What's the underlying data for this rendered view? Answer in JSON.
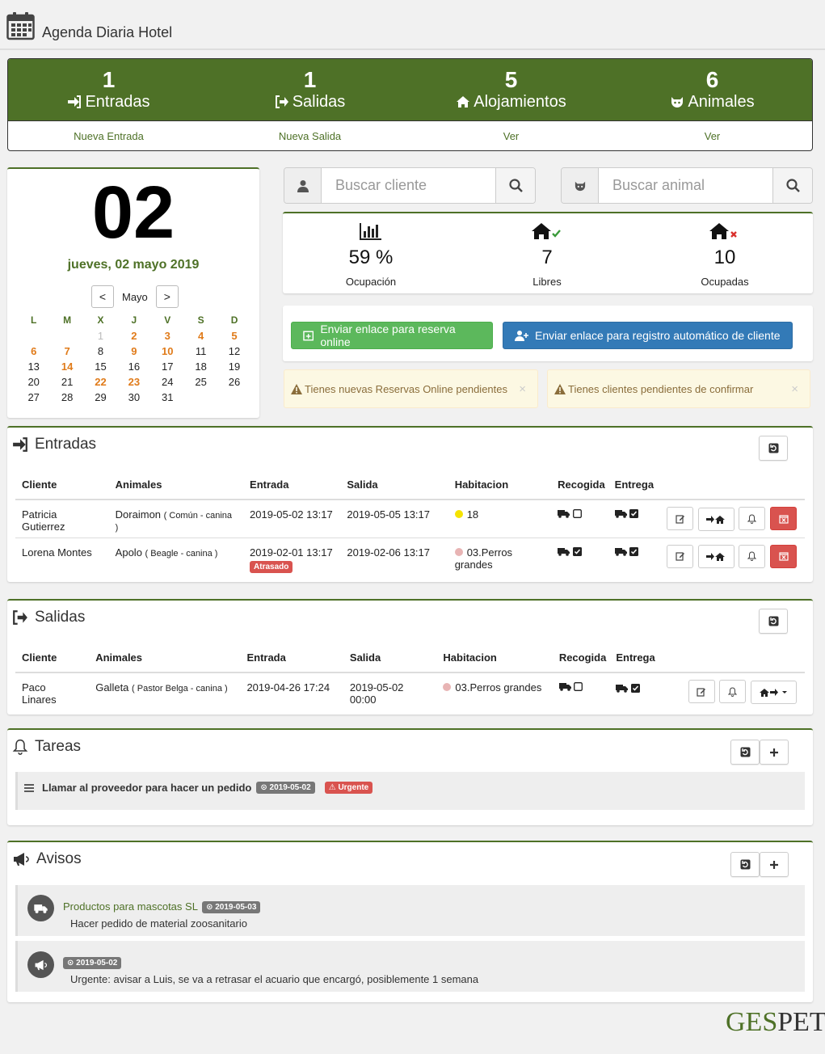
{
  "app": {
    "title": "Agenda Diaria Hotel"
  },
  "stats": [
    {
      "count": "1",
      "label": "Entradas",
      "link": "Nueva Entrada",
      "icon": "sign-in-icon"
    },
    {
      "count": "1",
      "label": "Salidas",
      "link": "Nueva Salida",
      "icon": "sign-out-icon"
    },
    {
      "count": "5",
      "label": "Alojamientos",
      "link": "Ver",
      "icon": "home-icon"
    },
    {
      "count": "6",
      "label": "Animales",
      "link": "Ver",
      "icon": "animal-icon"
    }
  ],
  "calendar": {
    "day": "02",
    "date_text": "jueves, 02 mayo 2019",
    "prev": "<",
    "next": ">",
    "month": "Mayo",
    "weekdays": [
      "L",
      "M",
      "X",
      "J",
      "V",
      "S",
      "D"
    ],
    "weeks": [
      [
        "",
        "",
        "1",
        "2",
        "3",
        "4",
        "5"
      ],
      [
        "6",
        "7",
        "8",
        "9",
        "10",
        "11",
        "12"
      ],
      [
        "13",
        "14",
        "15",
        "16",
        "17",
        "18",
        "19"
      ],
      [
        "20",
        "21",
        "22",
        "23",
        "24",
        "25",
        "26"
      ],
      [
        "27",
        "28",
        "29",
        "30",
        "31",
        "",
        ""
      ]
    ],
    "highlighted": [
      "2",
      "3",
      "4",
      "5",
      "6",
      "7",
      "9",
      "10",
      "14",
      "22",
      "23"
    ],
    "muted": [
      "1"
    ],
    "highlight_color": "#e07b1a"
  },
  "search": {
    "client_placeholder": "Buscar cliente",
    "animal_placeholder": "Buscar animal"
  },
  "occupancy": {
    "rate": "59 %",
    "rate_label": "Ocupación",
    "free": "7",
    "free_label": "Libres",
    "occupied": "10",
    "occupied_label": "Ocupadas"
  },
  "actions": {
    "online_booking": "Enviar enlace para reserva online",
    "auto_register": "Enviar enlace para registro automático de cliente"
  },
  "alerts": {
    "online_pending": "Tienes nuevas Reservas Online pendientes",
    "clients_pending": "Tienes clientes pendientes de confirmar",
    "close": "×"
  },
  "entradas": {
    "title": "Entradas",
    "columns": [
      "Cliente",
      "Animales",
      "Entrada",
      "Salida",
      "Habitacion",
      "Recogida",
      "Entrega"
    ],
    "rows": [
      {
        "cliente": "Patricia Gutierrez",
        "animal": "Doraimon",
        "animal_detail": "( Común - canina )",
        "entrada": "2019-05-02 13:17",
        "salida": "2019-05-05 13:17",
        "habitacion": "18",
        "room_color": "#f5e300",
        "badge": "",
        "recogida_checked": false,
        "entrega_checked": true
      },
      {
        "cliente": "Lorena Montes",
        "animal": "Apolo",
        "animal_detail": "( Beagle - canina )",
        "entrada": "2019-02-01 13:17",
        "salida": "2019-02-06 13:17",
        "habitacion": "03.Perros grandes",
        "room_color": "#e8b4b4",
        "badge": "Atrasado",
        "recogida_checked": true,
        "entrega_checked": true
      }
    ]
  },
  "salidas": {
    "title": "Salidas",
    "columns": [
      "Cliente",
      "Animales",
      "Entrada",
      "Salida",
      "Habitacion",
      "Recogida",
      "Entrega"
    ],
    "rows": [
      {
        "cliente": "Paco Linares",
        "animal": "Galleta",
        "animal_detail": "( Pastor Belga - canina )",
        "entrada": "2019-04-26 17:24",
        "salida": "2019-05-02 00:00",
        "habitacion": "03.Perros grandes",
        "room_color": "#e8b4b4",
        "recogida_checked": false,
        "entrega_checked": true
      }
    ]
  },
  "tareas": {
    "title": "Tareas",
    "items": [
      {
        "text": "Llamar al proveedor para hacer un pedido",
        "date": "2019-05-02",
        "priority": "Urgente"
      }
    ]
  },
  "avisos": {
    "title": "Avisos",
    "items": [
      {
        "sender": "Productos para mascotas SL",
        "date": "2019-05-03",
        "text": "Hacer pedido de material zoosanitario",
        "icon": "truck-icon"
      },
      {
        "sender": "",
        "date": "2019-05-02",
        "text": "Urgente: avisar a Luis, se va a retrasar el acuario que encargó, posiblemente 1 semana",
        "icon": "bullhorn-icon"
      }
    ]
  },
  "brand": {
    "part1": "GES",
    "part2": "PET",
    "color": "#4e7127"
  }
}
